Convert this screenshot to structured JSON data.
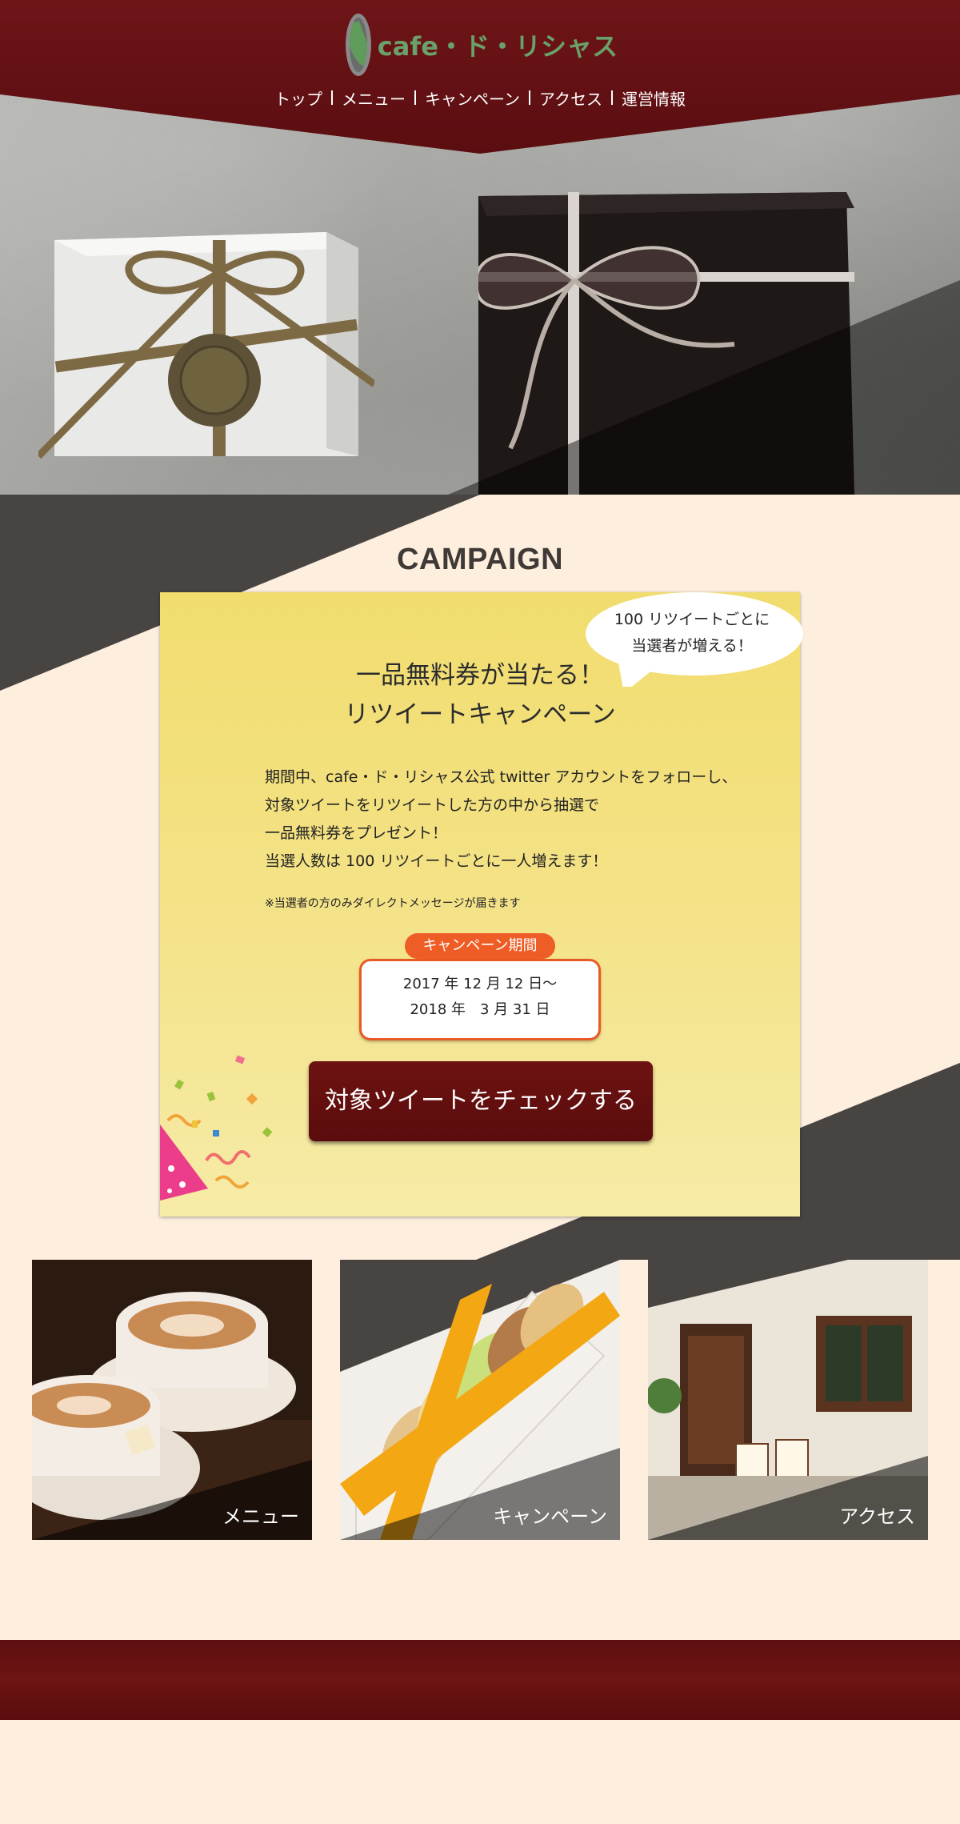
{
  "site": {
    "logo_text": "cafe・ド・リシャス"
  },
  "nav": {
    "items": [
      "トップ",
      "メニュー",
      "キャンペーン",
      "アクセス",
      "運営情報"
    ]
  },
  "campaign": {
    "heading": "CAMPAIGN",
    "bubble_line1": "100 リツイートごとに",
    "bubble_line2": "当選者が増える！",
    "title_line1": "一品無料券が当たる！",
    "title_line2": "リツイートキャンペーン",
    "body_line1": "期間中、cafe・ド・リシャス公式 twitter アカウントをフォローし、",
    "body_line2": "対象ツイートをリツイートした方の中から抽選で",
    "body_line3": "一品無料券をプレゼント！",
    "body_line4": "当選人数は 100 リツイートごとに一人増えます！",
    "note": "※当選者の方のみダイレクトメッセージが届きます",
    "period_label": "キャンペーン期間",
    "period_start": "2017 年 12 月 12 日〜",
    "period_end": "2018 年　3 月 31 日",
    "button_label": "対象ツイートをチェックする"
  },
  "tiles": {
    "menu_label": "メニュー",
    "campaign_label": "キャンペーン",
    "access_label": "アクセス"
  },
  "colors": {
    "header": "#6a1316",
    "background": "#fdeede",
    "dark_band": "#474442",
    "card": "#f3e07b",
    "accent_orange": "#ef5d26",
    "button": "#661010"
  }
}
